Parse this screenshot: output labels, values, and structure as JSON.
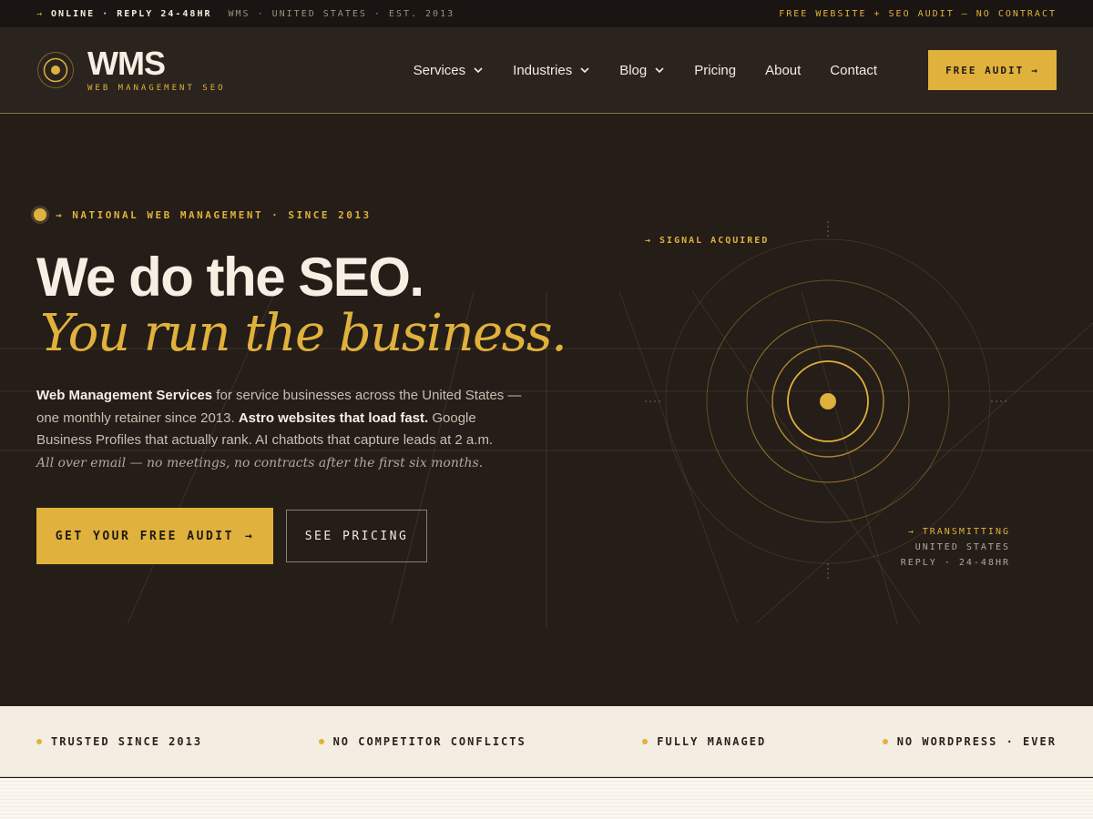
{
  "topbar": {
    "arrow": "→",
    "status": "ONLINE · REPLY 24-48HR",
    "meta": "WMS · UNITED STATES · EST. 2013",
    "promo": "FREE WEBSITE + SEO AUDIT — NO CONTRACT"
  },
  "header": {
    "logo_name": "WMS",
    "logo_sub": "WEB MANAGEMENT SEO",
    "nav": [
      {
        "label": "Services"
      },
      {
        "label": "Industries"
      },
      {
        "label": "Blog"
      },
      {
        "label": "Pricing"
      },
      {
        "label": "About"
      },
      {
        "label": "Contact"
      }
    ],
    "cta": "FREE AUDIT",
    "cta_arrow": "→"
  },
  "hero": {
    "eyebrow": "→ NATIONAL WEB MANAGEMENT · SINCE 2013",
    "headline": "We do the SEO.",
    "headline_italic": "You run the business.",
    "lead": {
      "bold1": "Web Management Services",
      "text1": " for service businesses across the United States — one monthly retainer since 2013. ",
      "bold2": "Astro websites that load fast.",
      "text2": " Google Business Profiles that actually rank. AI chatbots that capture leads at 2 a.m.",
      "note": "All over email — no meetings, no contracts after the first six months."
    },
    "primary_cta": "GET YOUR FREE AUDIT",
    "primary_arrow": "→",
    "secondary_cta": "SEE PRICING",
    "signal": "→ SIGNAL ACQUIRED",
    "transmitting": "→ TRANSMITTING",
    "location": "UNITED STATES",
    "reply": "REPLY · 24-48HR"
  },
  "trust": [
    {
      "label": "TRUSTED SINCE 2013"
    },
    {
      "label": "NO COMPETITOR CONFLICTS"
    },
    {
      "label": "FULLY MANAGED"
    },
    {
      "label": "NO WORDPRESS · EVER"
    }
  ],
  "colors": {
    "accent": "#e0b13c",
    "background": "#241d18",
    "cream": "#f4ede1"
  }
}
